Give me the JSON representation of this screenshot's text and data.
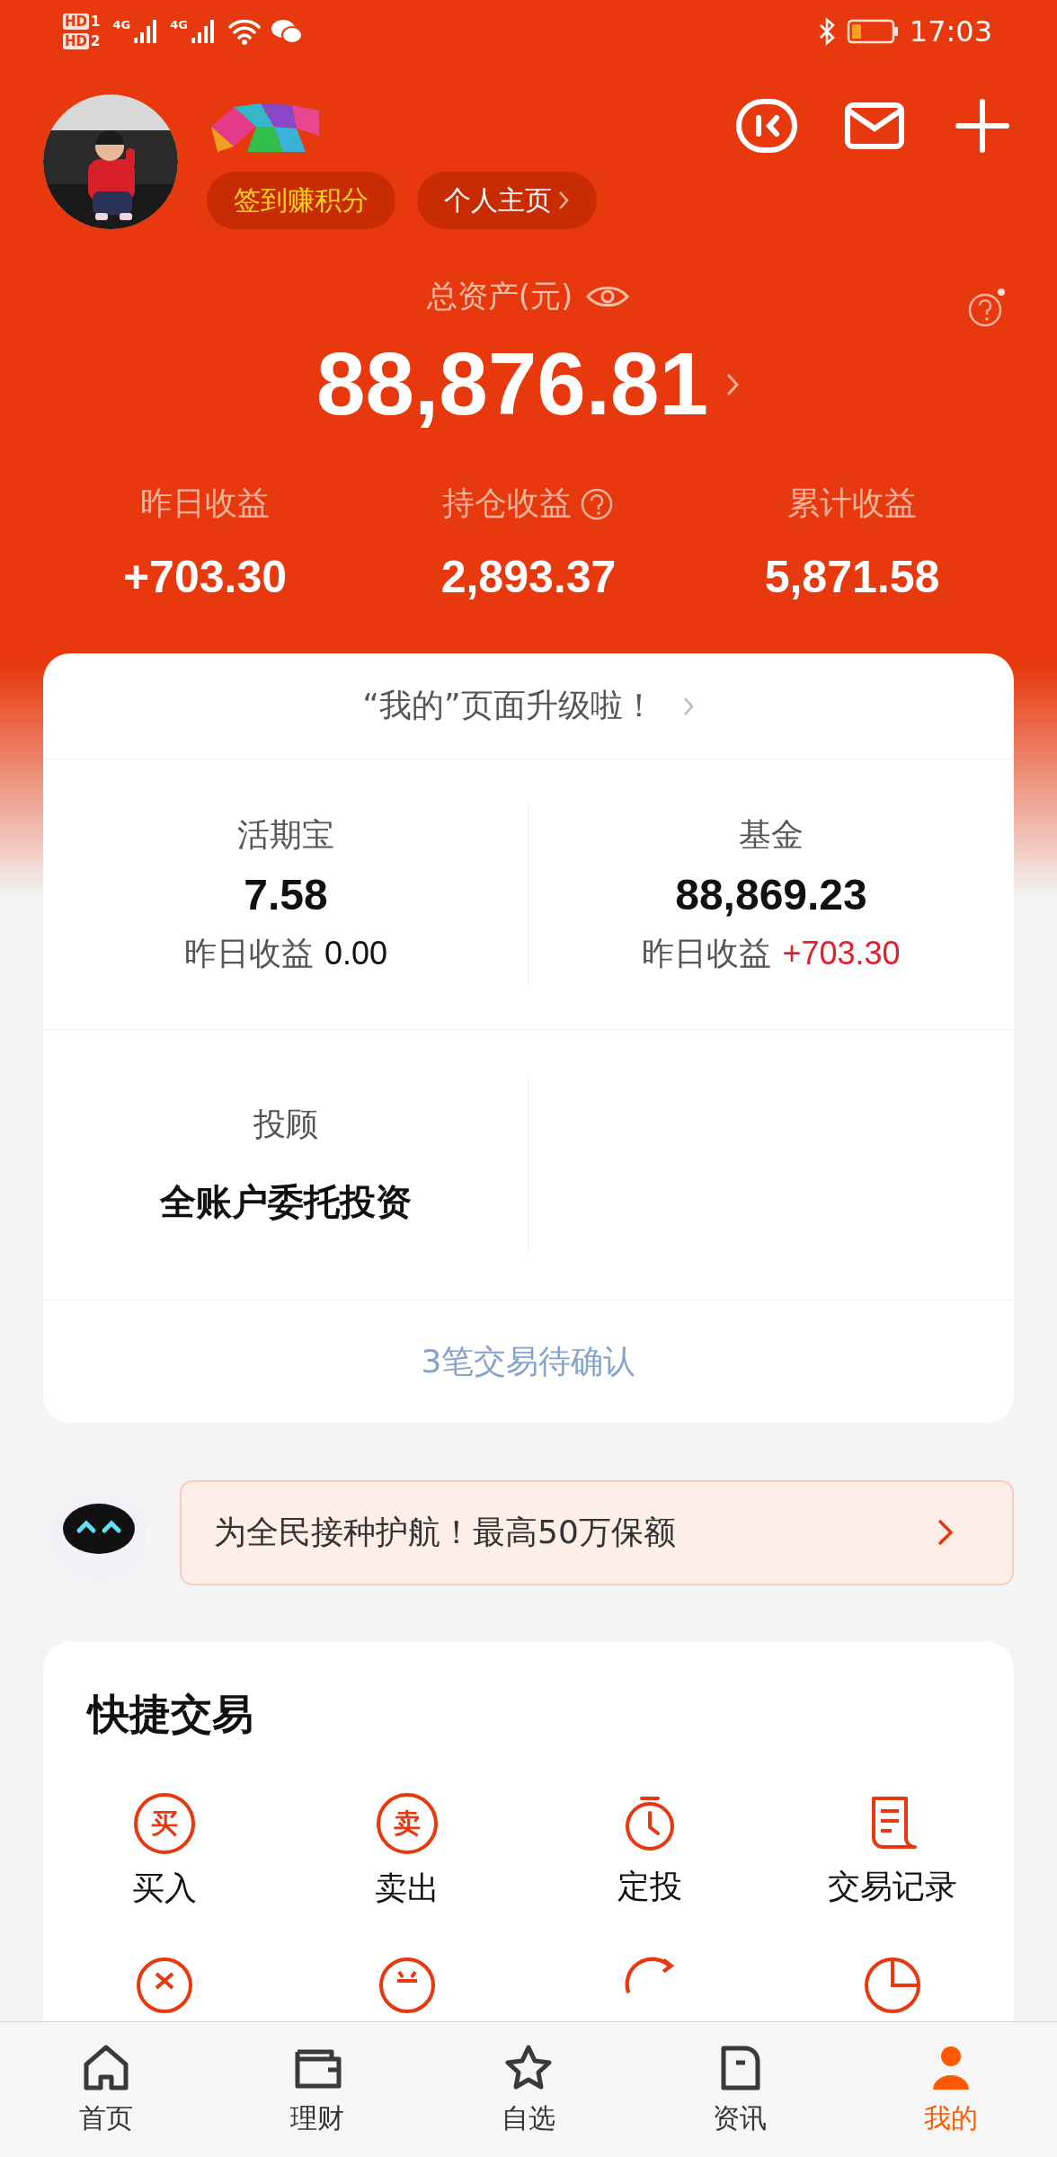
{
  "status_bar": {
    "sims": [
      {
        "badge": "HD",
        "slot": "1",
        "network": "4G"
      },
      {
        "badge": "HD",
        "slot": "2",
        "network": "4G"
      }
    ],
    "time": "17:03"
  },
  "profile": {
    "buttons": [
      {
        "label": "签到赚积分",
        "kind": "points"
      },
      {
        "label": "个人主页",
        "kind": "link"
      }
    ]
  },
  "assets": {
    "label": "总资产(元)",
    "total": "88,876.81"
  },
  "earnings": [
    {
      "label": "昨日收益",
      "value": "+703.30",
      "help": false
    },
    {
      "label": "持仓收益",
      "value": "2,893.37",
      "help": true
    },
    {
      "label": "累计收益",
      "value": "5,871.58",
      "help": false
    }
  ],
  "notice": "“我的”页面升级啦！",
  "holdings": [
    {
      "kind": "account",
      "name": "活期宝",
      "amount": "7.58",
      "yesterday_label": "昨日收益",
      "yesterday_value": "0.00",
      "positive": false
    },
    {
      "kind": "account",
      "name": "基金",
      "amount": "88,869.23",
      "yesterday_label": "昨日收益",
      "yesterday_value": "+703.30",
      "positive": true
    },
    {
      "kind": "advisor",
      "name": "投顾",
      "amount": "全账户委托投资"
    }
  ],
  "pending": "3笔交易待确认",
  "promo": "为全民接种护航！最高50万保额",
  "quick_trade": {
    "title": "快捷交易",
    "items": [
      {
        "kind": "buy",
        "glyph": "买",
        "label": "买入"
      },
      {
        "kind": "sell",
        "glyph": "卖",
        "label": "卖出"
      },
      {
        "kind": "timer",
        "label": "定投"
      },
      {
        "kind": "record",
        "label": "交易记录"
      },
      {
        "kind": "cross"
      },
      {
        "kind": "coin"
      },
      {
        "kind": "refresh"
      },
      {
        "kind": "pie"
      }
    ]
  },
  "tab_bar": [
    {
      "label": "首页",
      "kind": "home",
      "selected": false
    },
    {
      "label": "理财",
      "kind": "wallet",
      "selected": false
    },
    {
      "label": "自选",
      "kind": "star",
      "selected": false
    },
    {
      "label": "资讯",
      "kind": "doc",
      "selected": false
    },
    {
      "label": "我的",
      "kind": "person",
      "selected": true
    }
  ]
}
